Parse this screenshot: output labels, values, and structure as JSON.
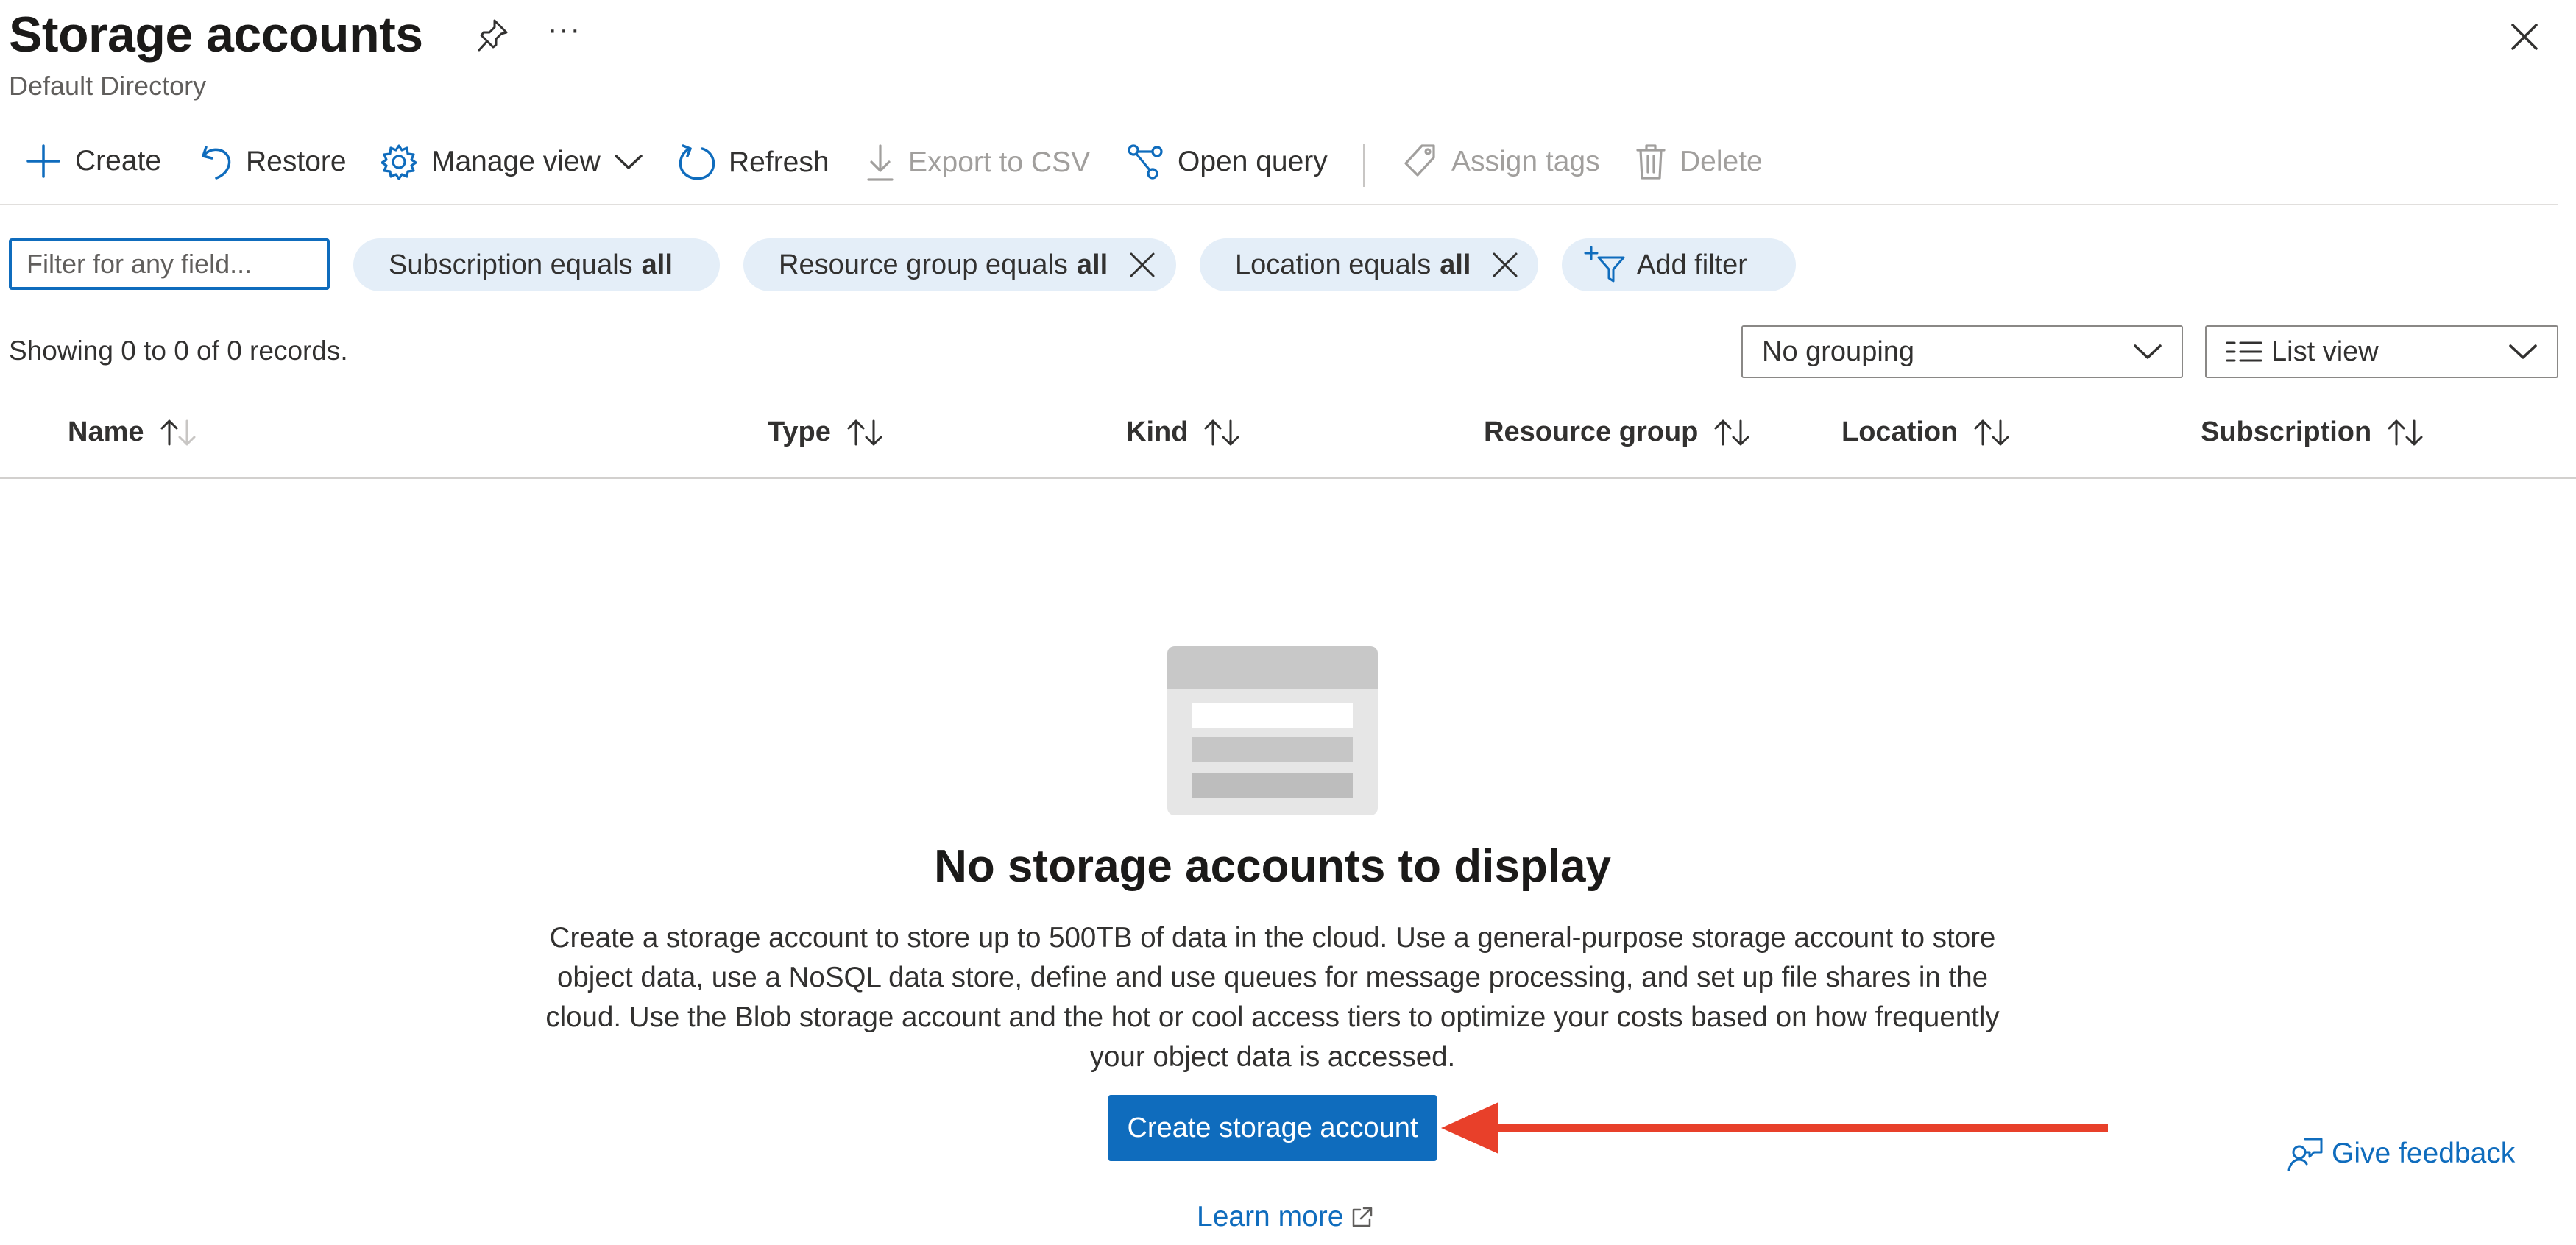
{
  "header": {
    "title": "Storage accounts",
    "subtitle": "Default Directory",
    "more_label": "···"
  },
  "toolbar": {
    "create": "Create",
    "restore": "Restore",
    "manage_view": "Manage view",
    "refresh": "Refresh",
    "export_csv": "Export to CSV",
    "open_query": "Open query",
    "assign_tags": "Assign tags",
    "delete": "Delete"
  },
  "filters": {
    "search_placeholder": "Filter for any field...",
    "pills": [
      {
        "label": "Subscription equals",
        "value": "all",
        "removable": false
      },
      {
        "label": "Resource group equals",
        "value": "all",
        "removable": true
      },
      {
        "label": "Location equals",
        "value": "all",
        "removable": true
      }
    ],
    "add_filter": "Add filter"
  },
  "records_text": "Showing 0 to 0 of 0 records.",
  "grouping": {
    "selected": "No grouping"
  },
  "view": {
    "selected": "List view"
  },
  "table": {
    "columns": [
      "Name",
      "Type",
      "Kind",
      "Resource group",
      "Location",
      "Subscription"
    ]
  },
  "empty_state": {
    "title": "No storage accounts to display",
    "description": "Create a storage account to store up to 500TB of data in the cloud. Use a general-purpose storage account to store object data, use a NoSQL data store, define and use queues for message processing, and set up file shares in the cloud. Use the Blob storage account and the hot or cool access tiers to optimize your costs based on how frequently your object data is accessed.",
    "cta": "Create storage account",
    "learn_more": "Learn more"
  },
  "feedback": "Give feedback",
  "colors": {
    "accent": "#0f6cbd",
    "pill_bg": "#e4eef8",
    "annotation_arrow": "#e8402a"
  },
  "icons": [
    "pin-icon",
    "close-icon",
    "plus-icon",
    "restore-icon",
    "gear-icon",
    "chevron-down-icon",
    "refresh-icon",
    "download-icon",
    "query-icon",
    "tag-icon",
    "trash-icon",
    "filter-add-icon",
    "sort-icon",
    "external-link-icon",
    "feedback-icon"
  ]
}
